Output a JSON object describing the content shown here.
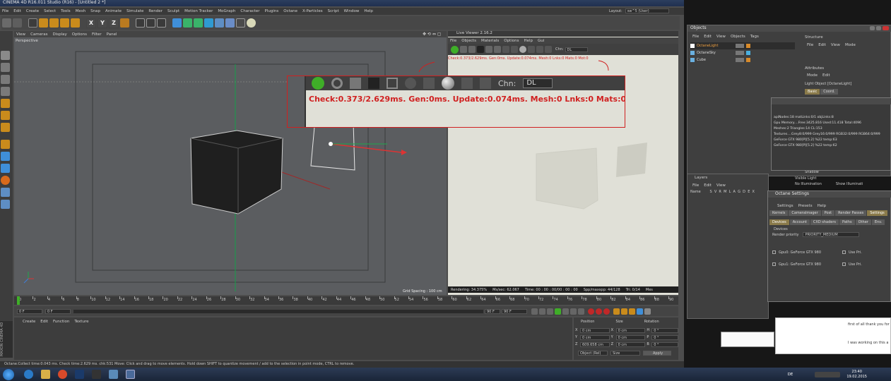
{
  "app": {
    "title": "CINEMA 4D R16.011 Studio (R16) - [Untitled 2 *]",
    "menu": [
      "File",
      "Edit",
      "Create",
      "Select",
      "Tools",
      "Mesh",
      "Snap",
      "Animate",
      "Simulate",
      "Render",
      "Sculpt",
      "Motion Tracker",
      "MoGraph",
      "Character",
      "Plugins",
      "Octane",
      "X-Particles",
      "Script",
      "Window",
      "Help"
    ],
    "layout_label": "Layout:",
    "layout_value": "sw^5 (User)",
    "toolbar_axes": [
      "X",
      "Y",
      "Z"
    ]
  },
  "viewport": {
    "menu": [
      "View",
      "Cameras",
      "Display",
      "Options",
      "Filter",
      "Panel"
    ],
    "name": "Perspective",
    "grid_spacing": "Grid Spacing : 100 cm"
  },
  "live_viewer": {
    "title": "Live Viewer 2.16.2",
    "menu": [
      "File",
      "Objects",
      "Materials",
      "Options",
      "Help",
      "Gui"
    ],
    "chn_label": "Chn:",
    "chn_value": "DL",
    "status_small": "Check:0.373/2.629ms. Gen:0ms. Update:0.074ms. Mesh:0 Lnks:0 Mats:0 Mot:0",
    "status_big": "Check:0.373/2.629ms. Gen:0ms. Update:0.074ms. Mesh:0 Lnks:0 Mats:0 Mot:0",
    "zoom_chn_label": "Chn:",
    "zoom_chn_value": "DL",
    "bottom": {
      "rendering": "Rendering: 34.375%",
      "mssec": "Ms/sec: 62.067",
      "time": "Time: 00 : 00 : 00/00 : 00 : 00",
      "spp": "Spp/maxspp: 44/128",
      "tri": "Tri: 0/14",
      "mesh": "Mes"
    }
  },
  "timeline": {
    "ticks": [
      "0",
      "2",
      "4",
      "6",
      "8",
      "10",
      "12",
      "14",
      "16",
      "18",
      "20",
      "22",
      "24",
      "26",
      "28",
      "30",
      "32",
      "34",
      "36",
      "38",
      "40",
      "42",
      "44",
      "46",
      "48",
      "50",
      "52",
      "54",
      "56",
      "58",
      "60",
      "62",
      "64",
      "66",
      "68",
      "70",
      "72",
      "74",
      "76",
      "78",
      "80",
      "82",
      "84",
      "86",
      "88",
      "90"
    ],
    "frame_end": "0 F",
    "start_field": "0 F",
    "cur_field": "0 F",
    "end_field": "90 F",
    "max_field": "90 F"
  },
  "materials": {
    "menu": [
      "Create",
      "Edit",
      "Function",
      "Texture"
    ]
  },
  "coords": {
    "headers": [
      "Position",
      "Size",
      "Rotation"
    ],
    "rows": [
      {
        "axis": "X",
        "pos": "0 cm",
        "axis2": "X",
        "size": "0 cm",
        "axis3": "H",
        "rot": "0 °"
      },
      {
        "axis": "Y",
        "pos": "0 cm",
        "axis2": "Y",
        "size": "0 cm",
        "axis3": "P",
        "rot": "0 °"
      },
      {
        "axis": "Z",
        "pos": "609.658 cm",
        "axis2": "Z",
        "size": "0 cm",
        "axis3": "B",
        "rot": "0 °"
      }
    ],
    "mode": "Object (Rel)",
    "size_mode": "Size",
    "apply": "Apply"
  },
  "status_bar": "Octane:Collect time:0.043 ms. Check time:2.629 ms. chk:531   Move: Click and drag to move elements. Hold down SHIFT to quantize movement / add to the selection in point mode, CTRL to remove.",
  "objects_panel": {
    "title": "Objects",
    "menu": [
      "File",
      "Edit",
      "View",
      "Objects",
      "Tags"
    ],
    "items": [
      "OctaneLight",
      "OctaneSky",
      "Cube"
    ],
    "struct_title": "Structure",
    "struct_menu": [
      "File",
      "Edit",
      "View",
      "Mode"
    ]
  },
  "attributes": {
    "title": "Attributes",
    "menu": [
      "Mode",
      "Edit"
    ],
    "object": "Light Object [OctaneLight]",
    "tabs": [
      "Basic",
      "Coord."
    ],
    "illum_label": "No Illumination",
    "visible_light": "Visible Light",
    "shadow": "Shadow",
    "show_illum": "Show Illuminati"
  },
  "info_window": {
    "lines": [
      "apiNodes:18  matLinks:0/1  objLinks:8",
      "Gpu Memory....Free:3425.816  Used:11.418  Total:4096",
      "Meshes:2  Triangles:14  CL:153",
      "Textures....Grey8:0/999   Grey16:0/999   RGB32:0/999   RGB64:0/999",
      "GeForce GTX 980[P][5.2] %22 temp:63",
      "GeForce GTX 980[P][5.2] %22 temp:62"
    ]
  },
  "layers": {
    "title": "Layers",
    "menu": [
      "File",
      "Edit",
      "View"
    ],
    "header": "Name        S  V  R  M  L  A  G  D  E  X"
  },
  "octane_settings": {
    "title": "Octane Settings",
    "menu": [
      "Settings",
      "Presets",
      "Help"
    ],
    "tabs1": [
      "Kernels",
      "CameraImager",
      "Post",
      "Render Passes",
      "Settings"
    ],
    "tabs2": [
      "Devices",
      "Account",
      "CXD shaders",
      "Paths",
      "Other",
      "Env."
    ],
    "section": "Devices",
    "priority_label": "Render priority",
    "priority_value": "PRIORITY_MEDIUM",
    "gpus": [
      {
        "name": "Gpu0: GeForce GTX 980",
        "use": "Use Pri."
      },
      {
        "name": "Gpu1: GeForce GTX 980",
        "use": "Use Pri."
      }
    ]
  },
  "browser_snippet": {
    "line1": "first of all thank you for",
    "line2": "I was working on this a"
  },
  "taskbar": {
    "lang": "DE",
    "time": "23:40",
    "date": "19.02.2015"
  }
}
